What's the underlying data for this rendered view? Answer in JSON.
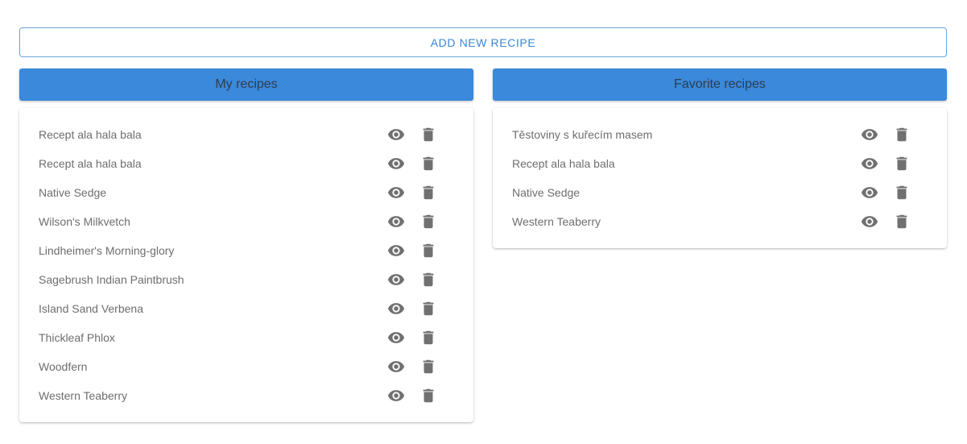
{
  "toolbar": {
    "add_label": "ADD NEW RECIPE"
  },
  "my_recipes": {
    "title": "My recipes",
    "items": [
      {
        "label": "Recept ala hala bala"
      },
      {
        "label": "Recept ala hala bala"
      },
      {
        "label": "Native Sedge"
      },
      {
        "label": "Wilson's Milkvetch"
      },
      {
        "label": "Lindheimer's Morning-glory"
      },
      {
        "label": "Sagebrush Indian Paintbrush"
      },
      {
        "label": "Island Sand Verbena"
      },
      {
        "label": "Thickleaf Phlox"
      },
      {
        "label": "Woodfern"
      },
      {
        "label": "Western Teaberry"
      }
    ]
  },
  "favorite_recipes": {
    "title": "Favorite recipes",
    "items": [
      {
        "label": "Těstoviny s kuřecím masem"
      },
      {
        "label": "Recept ala hala bala"
      },
      {
        "label": "Native Sedge"
      },
      {
        "label": "Western Teaberry"
      }
    ]
  },
  "icons": {
    "view": "eye-icon",
    "delete": "trash-icon"
  },
  "colors": {
    "accent": "#3a89db",
    "button_text": "#3a86d6",
    "icon": "#707070"
  }
}
